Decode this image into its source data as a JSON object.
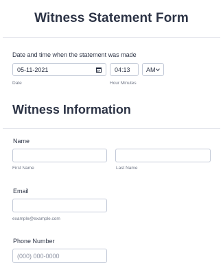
{
  "form": {
    "title": "Witness Statement Form"
  },
  "datetime": {
    "label": "Date and time when the statement was made",
    "date_value": "05-11-2021",
    "date_sublabel": "Date",
    "time_value": "04:13",
    "ampm_value": "AM",
    "time_sublabel": "Hour Minutes"
  },
  "witness": {
    "section_title": "Witness Information",
    "name_label": "Name",
    "first_name_sublabel": "First Name",
    "last_name_sublabel": "Last Name",
    "email_label": "Email",
    "email_sublabel": "example@example.com",
    "phone_label": "Phone Number",
    "phone_placeholder": "(000) 000-0000"
  },
  "icons": {
    "date": "calendar-icon",
    "ampm": "chevron-down-icon"
  },
  "colors": {
    "text": "#2c3345",
    "border": "#c3cad8",
    "divider": "#e3e5ec",
    "sublabel": "#6f7686"
  }
}
